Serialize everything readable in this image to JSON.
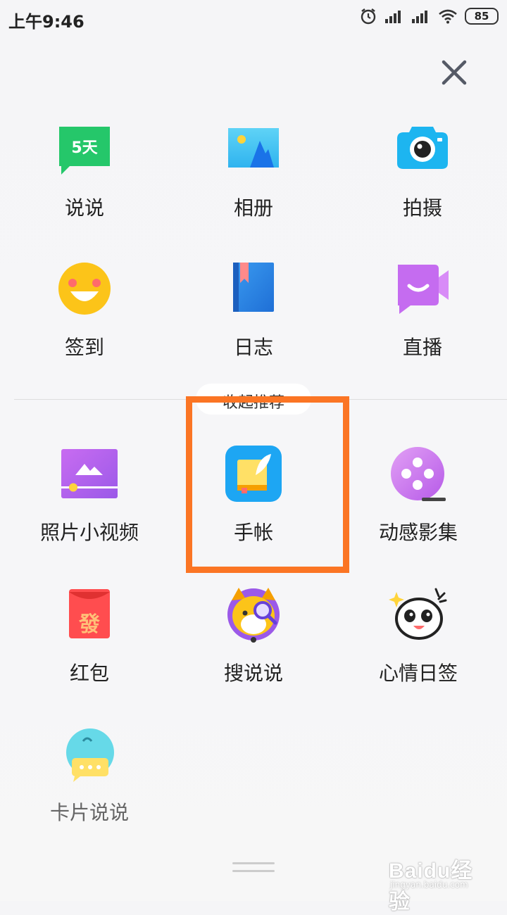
{
  "status_bar": {
    "time": "上午9:46",
    "battery": "85"
  },
  "grid": [
    {
      "label": "说说",
      "badge": "5天",
      "icon": "speech-bubble-icon"
    },
    {
      "label": "相册",
      "icon": "photo-album-icon"
    },
    {
      "label": "拍摄",
      "icon": "camera-icon"
    },
    {
      "label": "签到",
      "icon": "smiley-face-icon"
    },
    {
      "label": "日志",
      "icon": "book-icon"
    },
    {
      "label": "直播",
      "icon": "video-camera-icon"
    }
  ],
  "recommend_toggle": "收起推荐",
  "recommended": [
    {
      "label": "照片小视频",
      "icon": "photo-video-icon"
    },
    {
      "label": "手帐",
      "icon": "journal-icon"
    },
    {
      "label": "动感影集",
      "icon": "film-reel-icon"
    },
    {
      "label": "红包",
      "badge": "發",
      "icon": "red-envelope-icon"
    },
    {
      "label": "搜说说",
      "icon": "dog-magnifier-icon"
    },
    {
      "label": "心情日签",
      "icon": "panda-mood-icon"
    },
    {
      "label": "卡片说说",
      "icon": "card-bird-icon"
    }
  ],
  "highlight": {
    "color": "#fb7524",
    "target": "手帐"
  },
  "watermark": {
    "brand": "Baidu经验",
    "url": "jingyan.baidu.com"
  }
}
